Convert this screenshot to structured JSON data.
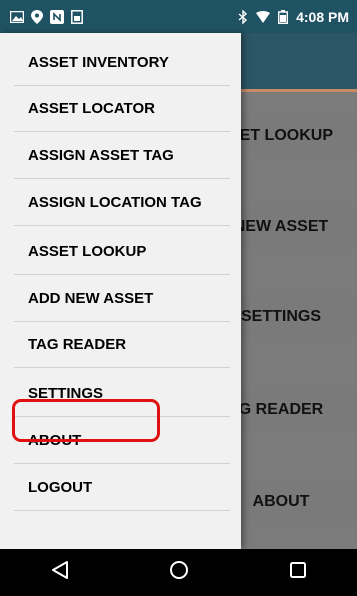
{
  "status_bar": {
    "time": "4:08 PM",
    "icons": [
      "gallery-icon",
      "location-icon",
      "nfc-icon",
      "notification-icon",
      "bluetooth-icon",
      "wifi-icon",
      "battery-icon"
    ]
  },
  "background": {
    "buttons": [
      "SET LOOKUP",
      "NEW ASSET",
      "SETTINGS",
      "G READER",
      "ABOUT"
    ]
  },
  "drawer": {
    "items": [
      {
        "label": "ASSET INVENTORY"
      },
      {
        "label": "ASSET LOCATOR"
      },
      {
        "label": "ASSIGN ASSET TAG"
      },
      {
        "label": "ASSIGN LOCATION TAG"
      },
      {
        "label": "ASSET LOOKUP"
      },
      {
        "label": "ADD NEW ASSET"
      },
      {
        "label": "TAG READER"
      },
      {
        "label": "SETTINGS"
      },
      {
        "label": "ABOUT"
      },
      {
        "label": "LOGOUT"
      }
    ],
    "highlighted_item": "SETTINGS"
  },
  "colors": {
    "status_bar": "#1f5262",
    "toolbar": "#2c5665",
    "accent_underline": "#c98b66",
    "drawer_bg": "#f1f1f1",
    "highlight_border": "#e01010"
  },
  "nav_bar": {
    "buttons": [
      "back-icon",
      "home-icon",
      "recents-icon"
    ]
  }
}
